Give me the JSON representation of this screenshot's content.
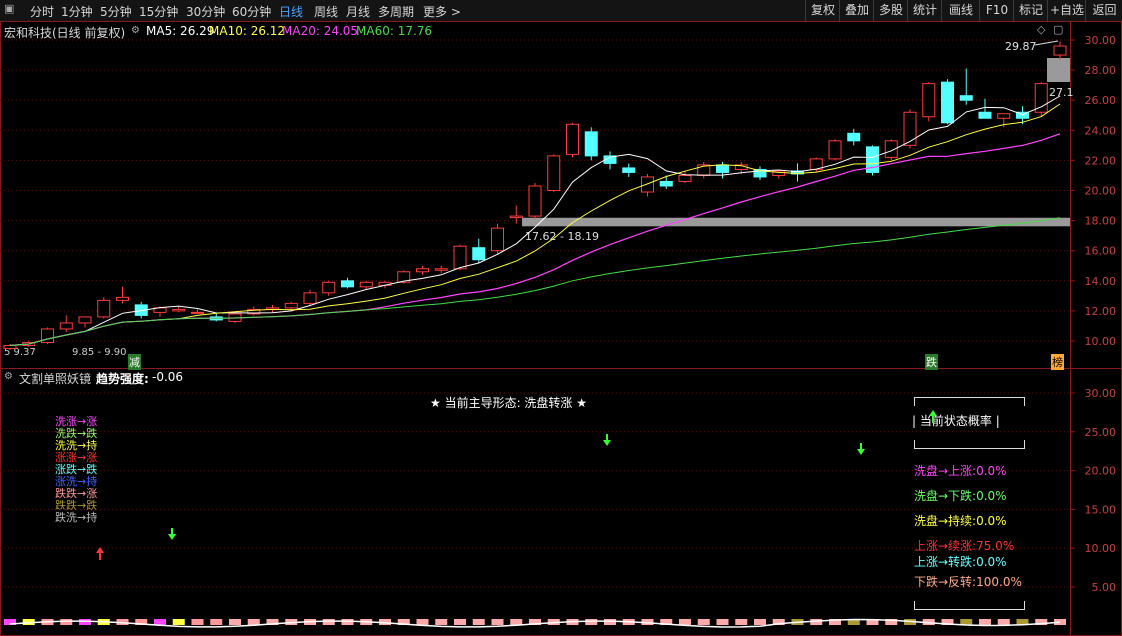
{
  "toolbar": {
    "periods": [
      "分时",
      "1分钟",
      "5分钟",
      "15分钟",
      "30分钟",
      "60分钟",
      "日线",
      "周线",
      "月线",
      "多周期",
      "更多 >"
    ],
    "active_period": "日线",
    "buttons": [
      "复权",
      "叠加",
      "多股",
      "统计",
      "画线",
      "F10",
      "标记",
      "+自选",
      "返回"
    ]
  },
  "stock": {
    "title": "宏和科技(日线 前复权)",
    "ma": [
      {
        "label": "MA5: 26.29",
        "color": "#ffffff"
      },
      {
        "label": "MA10: 26.12",
        "color": "#ffff44"
      },
      {
        "label": "MA20: 24.05",
        "color": "#ff44ff"
      },
      {
        "label": "MA60: 17.76",
        "color": "#44dd44"
      }
    ]
  },
  "main_chart": {
    "y_ticks": [
      "30.00",
      "28.00",
      "26.00",
      "24.00",
      "22.00",
      "20.00",
      "18.00",
      "16.00",
      "14.00",
      "12.00",
      "10.00"
    ],
    "high_label": "29.87",
    "last_price_label": "27.1",
    "zone_label": "17.62 - 18.19",
    "low_labels": [
      "5  9.37",
      "9.85 - 9.90"
    ],
    "markers": [
      {
        "text": "减",
        "color": "#33cc33"
      },
      {
        "text": "跌",
        "color": "#33cc33"
      },
      {
        "text": "榜",
        "color": "#ffaa33"
      }
    ],
    "candles": [
      {
        "o": 9.5,
        "h": 9.8,
        "l": 9.4,
        "c": 9.7
      },
      {
        "o": 9.7,
        "h": 10.0,
        "l": 9.6,
        "c": 9.9
      },
      {
        "o": 9.9,
        "h": 10.9,
        "l": 9.8,
        "c": 10.8
      },
      {
        "o": 10.8,
        "h": 11.7,
        "l": 10.6,
        "c": 11.2
      },
      {
        "o": 11.2,
        "h": 11.4,
        "l": 10.9,
        "c": 11.6
      },
      {
        "o": 11.6,
        "h": 12.9,
        "l": 11.5,
        "c": 12.7
      },
      {
        "o": 12.7,
        "h": 13.6,
        "l": 12.5,
        "c": 12.9
      },
      {
        "o": 12.4,
        "h": 12.6,
        "l": 11.5,
        "c": 11.7
      },
      {
        "o": 11.9,
        "h": 12.3,
        "l": 11.6,
        "c": 12.2
      },
      {
        "o": 12.0,
        "h": 12.3,
        "l": 11.9,
        "c": 12.1
      },
      {
        "o": 11.9,
        "h": 12.1,
        "l": 11.8,
        "c": 11.9
      },
      {
        "o": 11.6,
        "h": 11.9,
        "l": 11.3,
        "c": 11.4
      },
      {
        "o": 11.3,
        "h": 11.9,
        "l": 11.2,
        "c": 11.8
      },
      {
        "o": 11.8,
        "h": 12.3,
        "l": 11.7,
        "c": 12.1
      },
      {
        "o": 12.1,
        "h": 12.4,
        "l": 11.9,
        "c": 12.2
      },
      {
        "o": 12.2,
        "h": 12.6,
        "l": 12.0,
        "c": 12.5
      },
      {
        "o": 12.5,
        "h": 13.4,
        "l": 12.3,
        "c": 13.2
      },
      {
        "o": 13.2,
        "h": 14.0,
        "l": 13.0,
        "c": 13.9
      },
      {
        "o": 14.0,
        "h": 14.2,
        "l": 13.5,
        "c": 13.6
      },
      {
        "o": 13.6,
        "h": 14.0,
        "l": 13.4,
        "c": 13.9
      },
      {
        "o": 13.7,
        "h": 14.0,
        "l": 13.5,
        "c": 13.9
      },
      {
        "o": 13.9,
        "h": 14.7,
        "l": 13.8,
        "c": 14.6
      },
      {
        "o": 14.6,
        "h": 15.0,
        "l": 14.4,
        "c": 14.8
      },
      {
        "o": 14.7,
        "h": 15.0,
        "l": 14.5,
        "c": 14.8
      },
      {
        "o": 14.8,
        "h": 16.4,
        "l": 14.7,
        "c": 16.3
      },
      {
        "o": 16.2,
        "h": 16.8,
        "l": 15.2,
        "c": 15.4
      },
      {
        "o": 16.0,
        "h": 17.8,
        "l": 15.8,
        "c": 17.5
      },
      {
        "o": 18.2,
        "h": 19.0,
        "l": 17.8,
        "c": 18.3
      },
      {
        "o": 18.3,
        "h": 20.5,
        "l": 18.1,
        "c": 20.3
      },
      {
        "o": 20.0,
        "h": 22.4,
        "l": 19.9,
        "c": 22.3
      },
      {
        "o": 22.4,
        "h": 24.5,
        "l": 22.2,
        "c": 24.4
      },
      {
        "o": 23.9,
        "h": 24.2,
        "l": 22.0,
        "c": 22.3
      },
      {
        "o": 22.3,
        "h": 22.6,
        "l": 21.4,
        "c": 21.8
      },
      {
        "o": 21.5,
        "h": 21.8,
        "l": 20.9,
        "c": 21.2
      },
      {
        "o": 19.9,
        "h": 21.1,
        "l": 19.6,
        "c": 20.9
      },
      {
        "o": 20.6,
        "h": 21.0,
        "l": 20.1,
        "c": 20.3
      },
      {
        "o": 20.6,
        "h": 21.3,
        "l": 20.5,
        "c": 21.0
      },
      {
        "o": 21.0,
        "h": 21.9,
        "l": 20.8,
        "c": 21.7
      },
      {
        "o": 21.7,
        "h": 21.9,
        "l": 20.8,
        "c": 21.2
      },
      {
        "o": 21.4,
        "h": 21.9,
        "l": 21.1,
        "c": 21.7
      },
      {
        "o": 21.4,
        "h": 21.6,
        "l": 20.7,
        "c": 20.9
      },
      {
        "o": 21.0,
        "h": 21.4,
        "l": 20.8,
        "c": 21.3
      },
      {
        "o": 21.3,
        "h": 21.8,
        "l": 20.6,
        "c": 21.1
      },
      {
        "o": 21.4,
        "h": 22.2,
        "l": 21.2,
        "c": 22.1
      },
      {
        "o": 22.1,
        "h": 23.4,
        "l": 22.0,
        "c": 23.3
      },
      {
        "o": 23.8,
        "h": 24.1,
        "l": 23.0,
        "c": 23.3
      },
      {
        "o": 22.9,
        "h": 23.0,
        "l": 21.0,
        "c": 21.2
      },
      {
        "o": 22.2,
        "h": 23.4,
        "l": 22.0,
        "c": 23.3
      },
      {
        "o": 23.0,
        "h": 25.4,
        "l": 22.8,
        "c": 25.2
      },
      {
        "o": 24.9,
        "h": 27.2,
        "l": 24.6,
        "c": 27.1
      },
      {
        "o": 27.2,
        "h": 27.4,
        "l": 24.4,
        "c": 24.5
      },
      {
        "o": 26.3,
        "h": 28.1,
        "l": 25.7,
        "c": 26.0
      },
      {
        "o": 25.2,
        "h": 26.1,
        "l": 24.9,
        "c": 24.8
      },
      {
        "o": 24.8,
        "h": 25.1,
        "l": 24.2,
        "c": 25.1
      },
      {
        "o": 25.2,
        "h": 25.6,
        "l": 24.4,
        "c": 24.8
      },
      {
        "o": 25.2,
        "h": 27.2,
        "l": 24.9,
        "c": 27.1
      },
      {
        "o": 29.0,
        "h": 29.9,
        "l": 28.7,
        "c": 29.6
      }
    ]
  },
  "sub_chart": {
    "title": "文割单照妖镜",
    "strength_label": "趋势强度:",
    "strength_value": "-0.06",
    "center_text": "★ 当前主导形态: 洗盘转涨 ★",
    "y_ticks": [
      "30.00",
      "25.00",
      "20.00",
      "15.00",
      "10.00",
      "5.00"
    ],
    "legend": [
      {
        "text": "洗涨→涨",
        "color": "#ff44ff"
      },
      {
        "text": "洗跌→跌",
        "color": "#99ff66"
      },
      {
        "text": "洗洗→持",
        "color": "#ffff44"
      },
      {
        "text": "涨涨→涨",
        "color": "#ff3333"
      },
      {
        "text": "涨跌→跌",
        "color": "#66ffff"
      },
      {
        "text": "涨洗→持",
        "color": "#4466ff"
      },
      {
        "text": "跌跌→涨",
        "color": "#ff9999"
      },
      {
        "text": "跌跌→跌",
        "color": "#aa9933"
      },
      {
        "text": "跌洗→持",
        "color": "#bbbbbb"
      }
    ],
    "panel_title": "当前状态概率",
    "panel_rows": [
      {
        "text": "洗盘→上涨:0.0%",
        "color": "#ff44ff"
      },
      {
        "text": "洗盘→下跌:0.0%",
        "color": "#66ff66"
      },
      {
        "text": "洗盘→持续:0.0%",
        "color": "#ffff44"
      },
      {
        "text": "上涨→续涨:75.0%",
        "color": "#ff3333"
      },
      {
        "text": "上涨→转跌:0.0%",
        "color": "#66ffff"
      },
      {
        "text": "下跌→反转:100.0%",
        "color": "#ffaa88"
      }
    ]
  }
}
